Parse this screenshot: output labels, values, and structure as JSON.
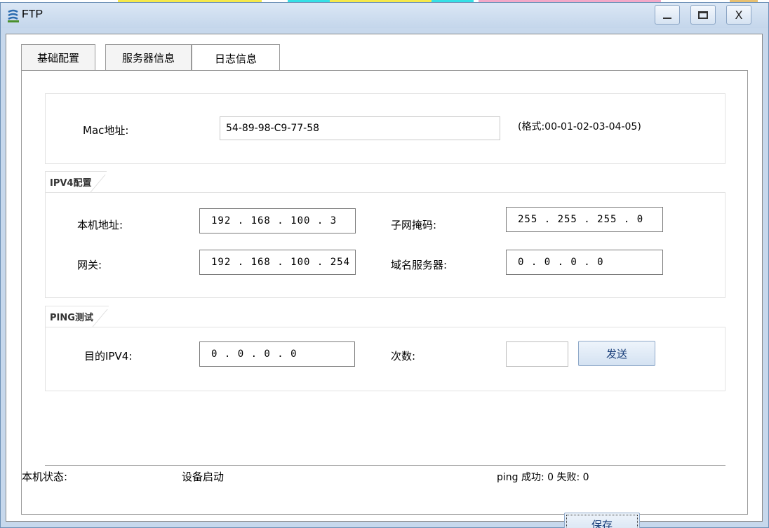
{
  "window": {
    "title": "FTP",
    "close_label": "X"
  },
  "tabs": [
    {
      "label": "基础配置"
    },
    {
      "label": "服务器信息"
    },
    {
      "label": "日志信息"
    }
  ],
  "mac": {
    "label": "Mac地址:",
    "value": "54-89-98-C9-77-58",
    "hint": "(格式:00-01-02-03-04-05)"
  },
  "ipv4": {
    "legend": "IPV4配置",
    "host_label": "本机地址:",
    "host_value": "192 . 168 . 100 . 3",
    "mask_label": "子网掩码:",
    "mask_value": "255 . 255 . 255 . 0",
    "gateway_label": "网关:",
    "gateway_value": "192 . 168 . 100 . 254",
    "dns_label": "域名服务器:",
    "dns_value": "0 . 0 . 0 . 0"
  },
  "ping": {
    "legend": "PING测试",
    "dest_label": "目的IPV4:",
    "dest_value": "0 . 0 . 0 . 0",
    "count_label": "次数:",
    "count_value": "",
    "send_label": "发送"
  },
  "status": {
    "label": "本机状态:",
    "value": "设备启动",
    "ping_result": "ping 成功: 0 失败: 0"
  },
  "save_label": "保存"
}
